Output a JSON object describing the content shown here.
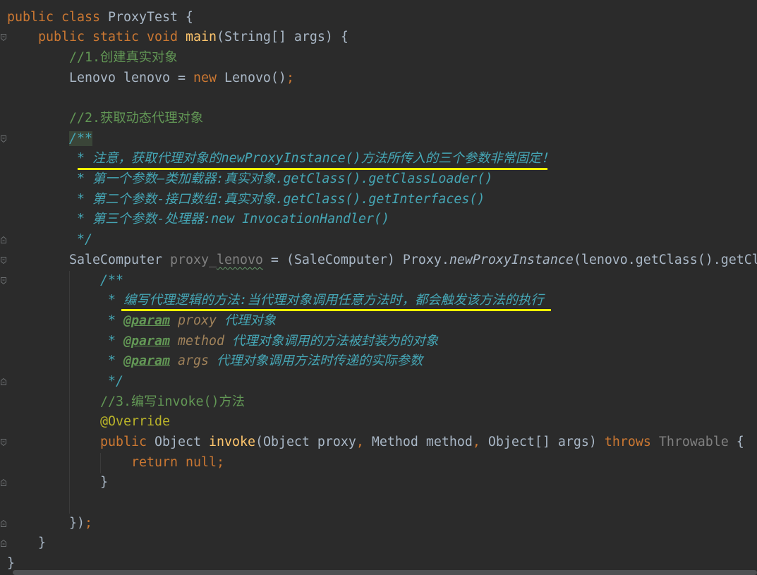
{
  "colors": {
    "background": "#2B2B2B",
    "text": "#A9B7C6",
    "keyword": "#CC7832",
    "method_declaration": "#FFC66D",
    "line_comment": "#629755",
    "doc_comment": "#45A6B5",
    "javadoc_tag": "#629755",
    "javadoc_param": "#A0825A",
    "annotation": "#BBB529",
    "unused": "#808080",
    "typo_underline": "#659C6B",
    "match_highlight": "#3A4538",
    "highlight_mark": "#FFFF00",
    "scrollbar": "#4E5052",
    "indent_guide": "#3B3B3B",
    "fold_marker": "#6B6E70"
  },
  "editor": {
    "lines": [
      [
        "public class ",
        "ProxyTest {"
      ],
      [
        "public static void ",
        "main",
        "(String[] args) {"
      ],
      [
        "//1.创建真实对象"
      ],
      [
        "Lenovo lenovo = ",
        "new ",
        "Lenovo()",
        ";"
      ],
      [],
      [
        "//2.获取动态代理对象"
      ],
      [
        "/**"
      ],
      [
        "* 注意，获取代理对象的newProxyInstance()方法所传入的三个参数非常固定！"
      ],
      [
        "* 第一个参数—类加载器:真实对象.getClass().getClassLoader()"
      ],
      [
        "* 第二个参数-接口数组:真实对象.getClass().getInterfaces()"
      ],
      [
        "* 第三个参数-处理器:new InvocationHandler()"
      ],
      [
        "*/"
      ],
      [
        "SaleComputer ",
        "proxy_",
        "lenovo",
        " = (SaleComputer) Proxy.",
        "newProxyInstance",
        "(lenovo.getClass().getCl"
      ],
      [
        "/**"
      ],
      [
        "* 编写代理逻辑的方法:当代理对象调用任意方法时，都会触发该方法的执行"
      ],
      [
        "* ",
        "@param",
        " proxy",
        " 代理对象"
      ],
      [
        "* ",
        "@param",
        " method",
        " 代理对象调用的方法被封装为的对象"
      ],
      [
        "* ",
        "@param",
        " args",
        " 代理对象调用方法时传递的实际参数"
      ],
      [
        "*/"
      ],
      [
        "//3.编写invoke()方法"
      ],
      [
        "@Override"
      ],
      [
        "public ",
        "Object ",
        "invoke",
        "(Object proxy",
        ", ",
        "Method method",
        ", ",
        "Object[] args) ",
        "throws ",
        "Throwable",
        " {"
      ],
      [
        "return null;"
      ],
      [
        "}"
      ],
      [],
      [
        "})",
        ";"
      ],
      [
        "}"
      ],
      [
        "}"
      ]
    ]
  }
}
